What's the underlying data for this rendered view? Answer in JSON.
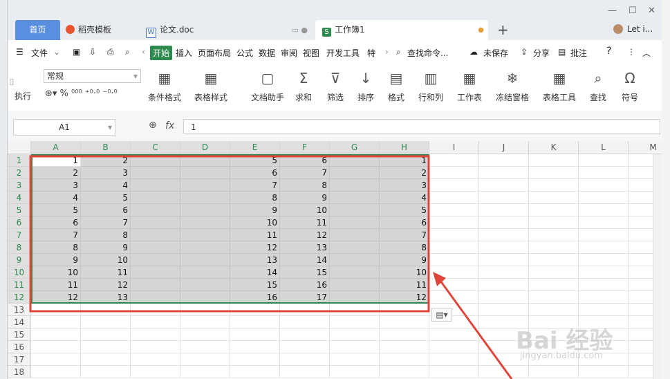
{
  "tabs": [
    {
      "label": "首页"
    },
    {
      "label": "稻壳模板"
    },
    {
      "label": "论文.doc"
    },
    {
      "label": "工作簿1"
    }
  ],
  "user": {
    "label": "Let i..."
  },
  "menu": {
    "file": "文件",
    "items": [
      "开始",
      "插入",
      "页面布局",
      "公式",
      "数据",
      "审阅",
      "视图",
      "开发工具",
      "特"
    ],
    "search": "查找命令...",
    "unsaved": "未保存",
    "share": "分享",
    "comment": "批注"
  },
  "ribbon": {
    "format_value": "常规",
    "left_label": "执行",
    "buttons": [
      {
        "label": "条件格式",
        "icon": "conditional-format-icon"
      },
      {
        "label": "表格样式",
        "icon": "table-style-icon"
      },
      {
        "label": "文档助手",
        "icon": "doc-assistant-icon"
      },
      {
        "label": "求和",
        "icon": "sum-icon"
      },
      {
        "label": "筛选",
        "icon": "filter-icon"
      },
      {
        "label": "排序",
        "icon": "sort-icon"
      },
      {
        "label": "格式",
        "icon": "format-icon"
      },
      {
        "label": "行和列",
        "icon": "rows-cols-icon"
      },
      {
        "label": "工作表",
        "icon": "worksheet-icon"
      },
      {
        "label": "冻结窗格",
        "icon": "freeze-icon"
      },
      {
        "label": "表格工具",
        "icon": "table-tools-icon"
      },
      {
        "label": "查找",
        "icon": "find-icon"
      },
      {
        "label": "符号",
        "icon": "symbol-icon"
      }
    ]
  },
  "formula": {
    "cell_ref": "A1",
    "fx": "fx",
    "value": "1"
  },
  "grid": {
    "columns": [
      "A",
      "B",
      "C",
      "D",
      "E",
      "F",
      "G",
      "H",
      "I",
      "J",
      "K",
      "L",
      "M"
    ],
    "row_numbers": [
      "1",
      "2",
      "3",
      "4",
      "5",
      "6",
      "7",
      "8",
      "9",
      "10",
      "11",
      "12",
      "13",
      "14",
      "15",
      "16",
      "17",
      "18"
    ],
    "data": [
      [
        "1",
        "2",
        "",
        "",
        "5",
        "6",
        "",
        "1"
      ],
      [
        "2",
        "3",
        "",
        "",
        "6",
        "7",
        "",
        "2"
      ],
      [
        "3",
        "4",
        "",
        "",
        "7",
        "8",
        "",
        "3"
      ],
      [
        "4",
        "5",
        "",
        "",
        "8",
        "9",
        "",
        "4"
      ],
      [
        "5",
        "6",
        "",
        "",
        "9",
        "10",
        "",
        "5"
      ],
      [
        "6",
        "7",
        "",
        "",
        "10",
        "11",
        "",
        "6"
      ],
      [
        "7",
        "8",
        "",
        "",
        "11",
        "12",
        "",
        "7"
      ],
      [
        "8",
        "9",
        "",
        "",
        "12",
        "13",
        "",
        "8"
      ],
      [
        "9",
        "10",
        "",
        "",
        "13",
        "14",
        "",
        "9"
      ],
      [
        "10",
        "11",
        "",
        "",
        "14",
        "15",
        "",
        "10"
      ],
      [
        "11",
        "12",
        "",
        "",
        "15",
        "16",
        "",
        "11"
      ],
      [
        "12",
        "13",
        "",
        "",
        "16",
        "17",
        "",
        "12"
      ]
    ]
  },
  "accent": {
    "green": "#2f8a4f",
    "highlight_red": "#e0453a",
    "home_tab_blue": "#5a8fe0"
  },
  "watermark": {
    "text": "Bai 经验",
    "sub": "jingyan.baidu.com"
  }
}
